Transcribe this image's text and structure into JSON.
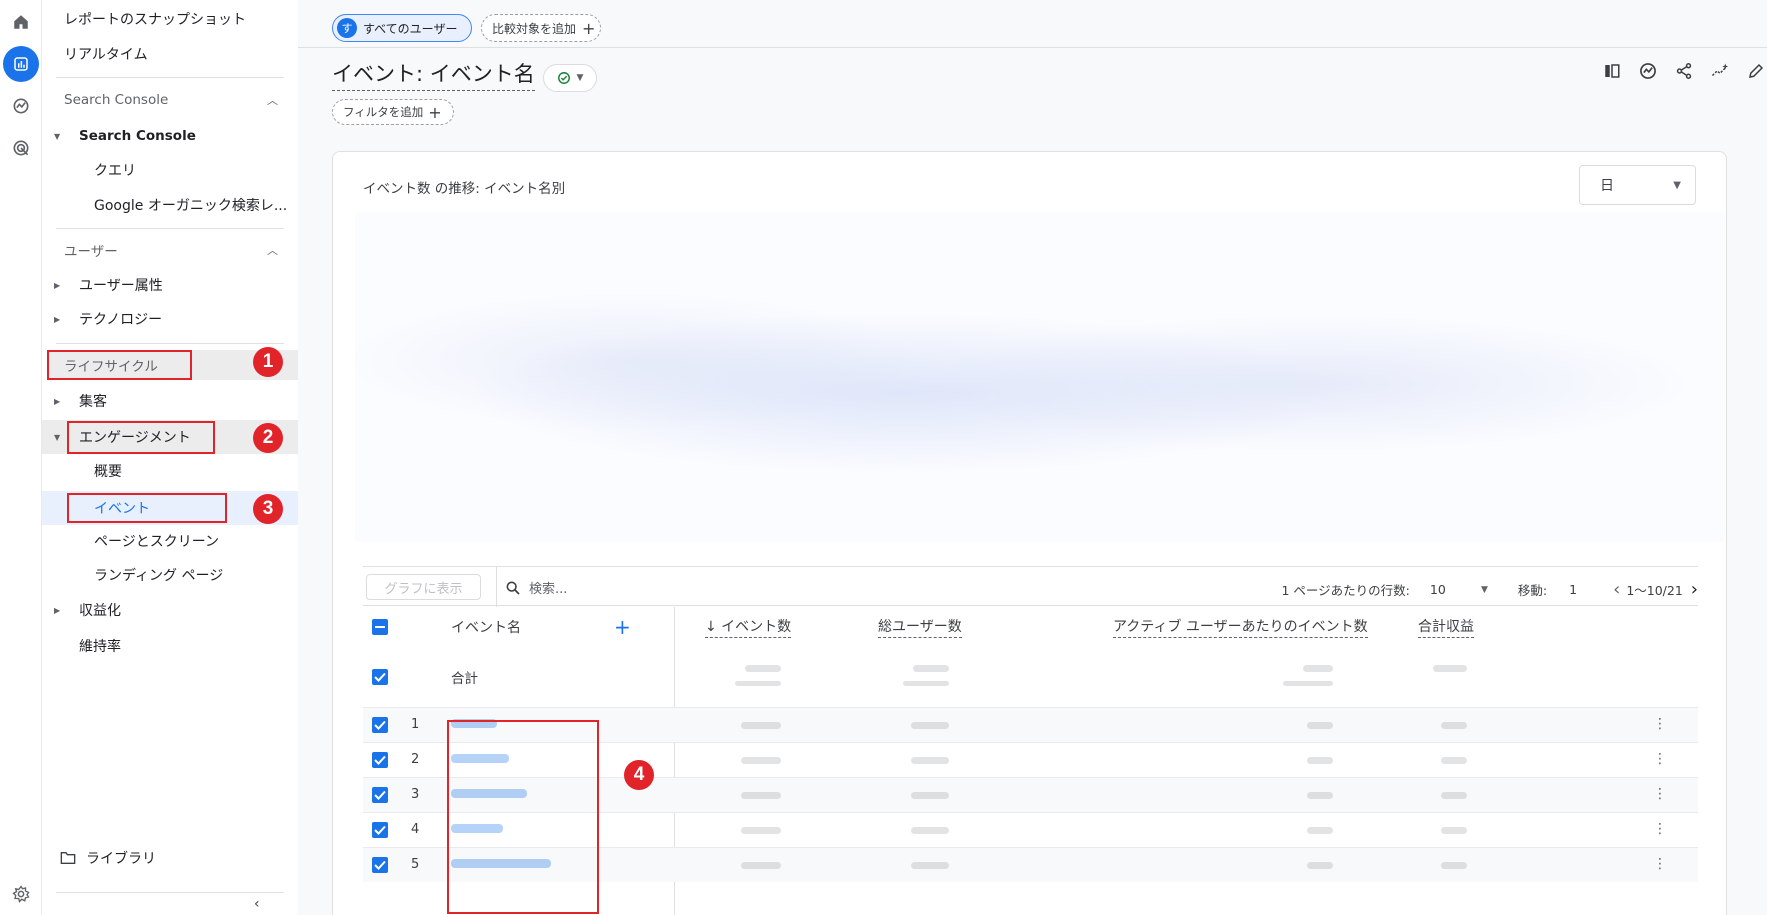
{
  "sidebar": {
    "items": [
      {
        "label": "レポートのスナップショット"
      },
      {
        "label": "リアルタイム"
      }
    ],
    "search_console_section": "Search Console",
    "search_console_group": "Search Console",
    "search_console_children": [
      "クエリ",
      "Google オーガニック検索レ..."
    ],
    "user_section": "ユーザー",
    "user_items": [
      "ユーザー属性",
      "テクノロジー"
    ],
    "lifecycle_section": "ライフサイクル",
    "acquisition": "集客",
    "engagement": "エンゲージメント",
    "engagement_children": [
      "概要",
      "イベント",
      "ページとスクリーン",
      "ランディング ページ"
    ],
    "monetization": "収益化",
    "retention": "維持率",
    "library": "ライブラリ"
  },
  "annotations": [
    "1",
    "2",
    "3",
    "4"
  ],
  "topbar": {
    "users_chip_avatar": "す",
    "users_chip": "すべてのユーザー",
    "compare_chip": "比較対象を追加"
  },
  "header": {
    "title": "イベント: イベント名",
    "filter_chip": "フィルタを追加"
  },
  "chart": {
    "title": "イベント数 の推移: イベント名別",
    "granularity": "日"
  },
  "table": {
    "show_graph_button": "グラフに表示",
    "search_placeholder": "検索...",
    "rows_per_page_label": "1 ページあたりの行数:",
    "rows_per_page_value": "10",
    "goto_label": "移動:",
    "goto_value": "1",
    "range": "1〜10/21",
    "columns": {
      "event_name": "イベント名",
      "event_count": "↓ イベント数",
      "total_users": "総ユーザー数",
      "per_active_user": "アクティブ ユーザーあたりのイベント数",
      "revenue": "合計収益"
    },
    "total_label": "合計",
    "rows": [
      {
        "index": "1"
      },
      {
        "index": "2"
      },
      {
        "index": "3"
      },
      {
        "index": "4"
      },
      {
        "index": "5"
      }
    ]
  },
  "colors": {
    "accent": "#1a73e8",
    "annotation_red": "#e1232a"
  }
}
